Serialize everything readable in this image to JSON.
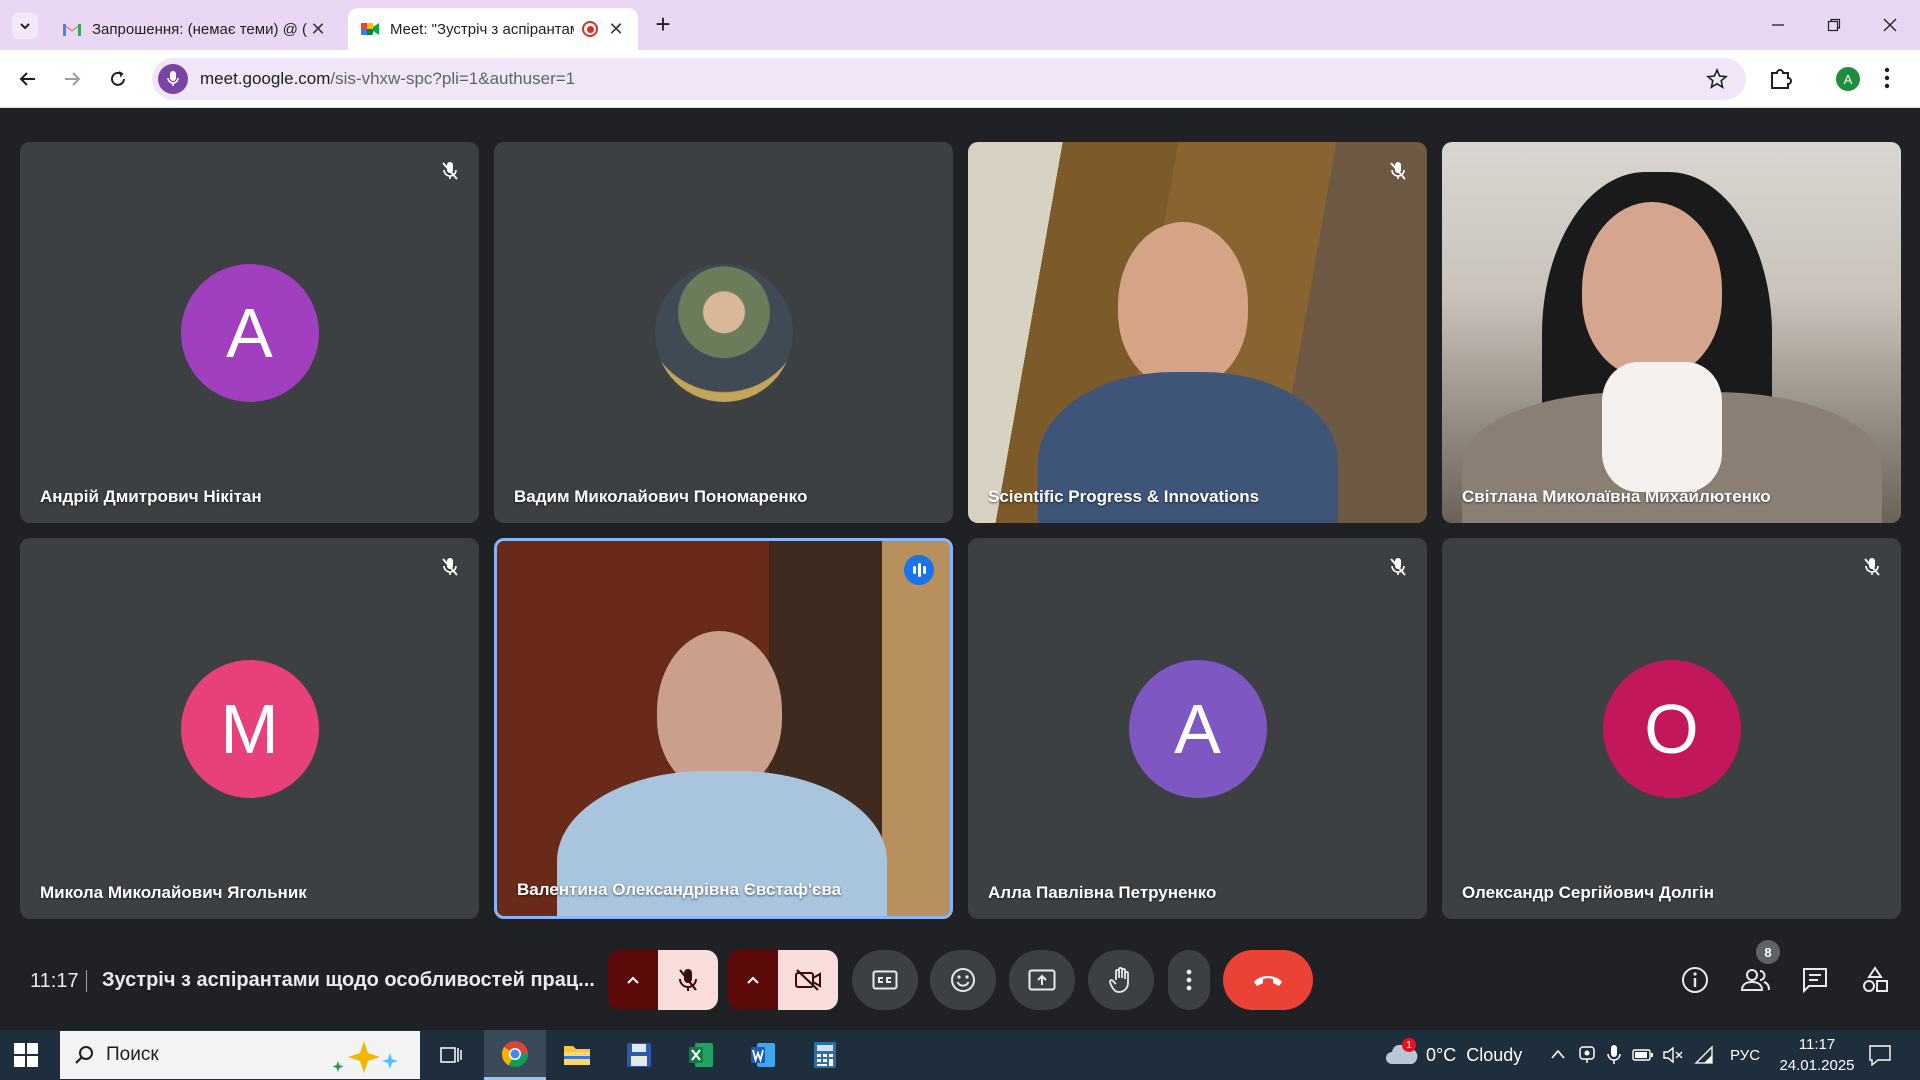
{
  "browser": {
    "tabs": [
      {
        "title": "Запрошення: (немає теми) @ (",
        "active": false
      },
      {
        "title": "Meet: \"Зустріч з аспірантами",
        "active": true
      }
    ],
    "new_tab": "+",
    "close": "✕",
    "url_host": "meet.google.com",
    "url_path": "/sis-vhxw-spc?pli=1&authuser=1",
    "profile_initial": "A"
  },
  "participants": [
    {
      "name": "Андрій Дмитрович Нікітан",
      "initial": "A",
      "avatar_color": "#a13fbf",
      "muted": true
    },
    {
      "name": "Вадим Миколайович Пономаренко",
      "initial": "",
      "avatar_color": "#7a8a5a",
      "muted": false
    },
    {
      "name": "Scientific Progress & Innovations",
      "initial": "",
      "muted": true
    },
    {
      "name": "Світлана Миколаївна Михайлютенко",
      "initial": "",
      "muted": false
    },
    {
      "name": "Микола Миколайович Ягольник",
      "initial": "M",
      "avatar_color": "#e8407a",
      "muted": true
    },
    {
      "name": "Валентина Олександрівна Євстаф'єва",
      "initial": "",
      "muted": false,
      "speaking": true
    },
    {
      "name": "Алла Павлівна Петруненко",
      "initial": "A",
      "avatar_color": "#7e57c2",
      "muted": true
    },
    {
      "name": "Олександр Сергійович Долгін",
      "initial": "O",
      "avatar_color": "#c2185b",
      "muted": true
    }
  ],
  "meeting": {
    "time": "11:17",
    "title": "Зустріч з аспірантами щодо особливостей прац...",
    "participant_count": "8"
  },
  "taskbar": {
    "search_placeholder": "Поиск",
    "weather": "0°C  Cloudy",
    "weather_badge": "1",
    "language": "РУС",
    "time": "11:17",
    "date": "24.01.2025"
  },
  "colors": {
    "meet_bg": "#202124",
    "tile_bg": "#3c4043",
    "hangup": "#ea4335",
    "muted_control_bg": "#f9dedc",
    "speaking_border": "#8ab4f8"
  }
}
